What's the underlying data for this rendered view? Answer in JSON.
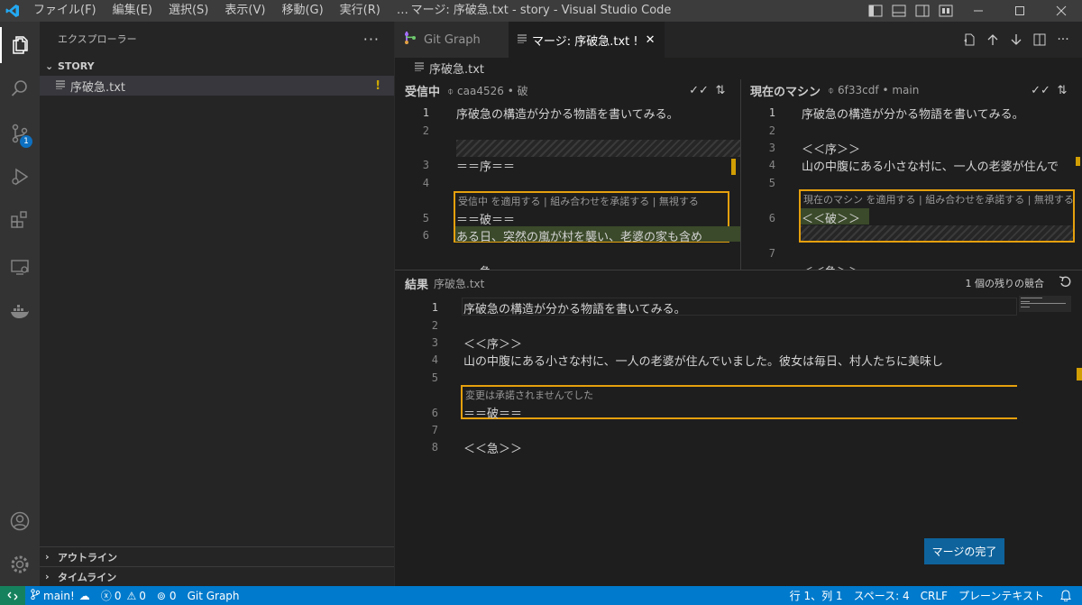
{
  "titlebar": {
    "menu": [
      "ファイル(F)",
      "編集(E)",
      "選択(S)",
      "表示(V)",
      "移動(G)",
      "実行(R)",
      "…"
    ],
    "title": "マージ: 序破急.txt - story - Visual Studio Code"
  },
  "activity": {
    "scm_badge": "1"
  },
  "sidebar": {
    "header": "エクスプローラー",
    "more": "···",
    "section": "STORY",
    "file": {
      "name": "序破急.txt",
      "status": "!"
    },
    "outline": "アウトライン",
    "timeline": "タイムライン"
  },
  "tabs": [
    {
      "label": "Git Graph"
    },
    {
      "label": "マージ: 序破急.txt !",
      "close": "✕"
    }
  ],
  "breadcrumb": "序破急.txt",
  "incoming": {
    "title": "受信中",
    "commit": "caa4526",
    "branch": "破",
    "lines": [
      {
        "num": "1",
        "text": "序破急の構造が分かる物語を書いてみる。"
      },
      {
        "num": "2",
        "text": ""
      },
      {
        "num": "3",
        "text": "＝＝序＝＝"
      },
      {
        "num": "4",
        "text": ""
      },
      {
        "num": "5",
        "text": "＝＝破＝＝"
      },
      {
        "num": "6",
        "text": "ある日、突然の嵐が村を襲い、老婆の家も含め"
      },
      {
        "num": "",
        "text": "＝＝急＝＝"
      }
    ],
    "codelens": "受信中 を適用する | 組み合わせを承諾する | 無視する"
  },
  "current": {
    "title": "現在のマシン",
    "commit": "6f33cdf",
    "branch": "main",
    "lines": [
      {
        "num": "1",
        "text": "序破急の構造が分かる物語を書いてみる。"
      },
      {
        "num": "2",
        "text": ""
      },
      {
        "num": "3",
        "text": "＜＜序＞＞"
      },
      {
        "num": "4",
        "text": "山の中腹にある小さな村に、一人の老婆が住んで"
      },
      {
        "num": "5",
        "text": ""
      },
      {
        "num": "6",
        "text": "＜＜破＞＞"
      },
      {
        "num": "7",
        "text": ""
      },
      {
        "num": "",
        "text": "＜＜急＞＞"
      }
    ],
    "codelens": "現在のマシン を適用する | 組み合わせを承諾する | 無視する"
  },
  "result": {
    "title": "結果",
    "file": "序破急.txt",
    "remaining": "1 個の残りの競合",
    "codelens": "変更は承諾されませんでした",
    "lines": [
      {
        "num": "1",
        "text": "序破急の構造が分かる物語を書いてみる。"
      },
      {
        "num": "2",
        "text": ""
      },
      {
        "num": "3",
        "text": "＜＜序＞＞"
      },
      {
        "num": "4",
        "text": "山の中腹にある小さな村に、一人の老婆が住んでいました。彼女は毎日、村人たちに美味し"
      },
      {
        "num": "5",
        "text": ""
      },
      {
        "num": "6",
        "text": "＝＝破＝＝"
      },
      {
        "num": "7",
        "text": ""
      },
      {
        "num": "8",
        "text": "＜＜急＞＞"
      }
    ],
    "complete_button": "マージの完了"
  },
  "statusbar": {
    "branch": "main!",
    "errors": "0",
    "warnings": "0",
    "ports": "0",
    "gitgraph": "Git Graph",
    "position": "行 1、列 1",
    "spaces": "スペース: 4",
    "eol": "CRLF",
    "language": "プレーンテキスト"
  },
  "colors": {
    "accent": "#007acc",
    "conflict": "#e5a00d",
    "button": "#0e639c"
  }
}
